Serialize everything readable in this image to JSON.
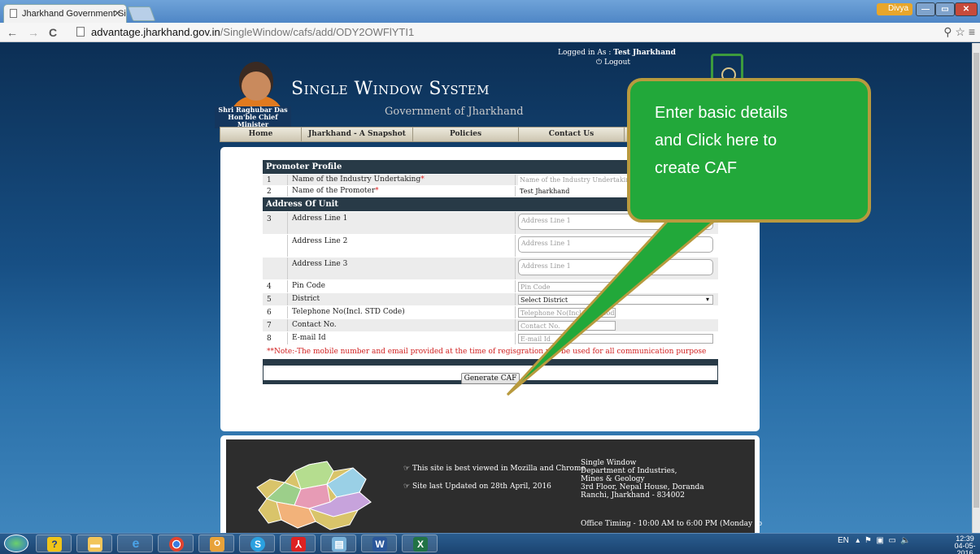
{
  "browser": {
    "tab_title": "Jharkhand Government Si",
    "user_badge": "Divya",
    "url_domain": "advantage.jharkhand.gov.in",
    "url_path": "/SingleWindow/cafs/add/ODY2OWFlYTI1"
  },
  "header": {
    "cm_name": "Shri Raghubar Das",
    "cm_title": "Hon'ble Chief Minister",
    "system_title": "Single Window System",
    "government": "Government of Jharkhand",
    "logged_in_label": "Logged in As :",
    "logged_in_user": "Test Jharkhand",
    "logout": "Logout"
  },
  "menu": [
    "Home",
    "Jharkhand - A Snapshot",
    "Policies",
    "Contact Us"
  ],
  "form": {
    "promoter_section": "Promoter Profile",
    "address_section": "Address Of Unit",
    "rows": [
      {
        "num": "1",
        "label": "Name of the Industry Undertaking",
        "required": "*",
        "placeholder": "Name of the Industry Undertaking",
        "value": ""
      },
      {
        "num": "2",
        "label": "Name of the Promoter",
        "required": "*",
        "placeholder": "",
        "value": "Test Jharkhand"
      },
      {
        "num": "3",
        "label": "Address Line 1",
        "placeholder": "Address Line 1"
      },
      {
        "num": "",
        "label": "Address Line 2",
        "placeholder": "Address Line 1"
      },
      {
        "num": "",
        "label": "Address Line 3",
        "placeholder": "Address Line 1"
      },
      {
        "num": "4",
        "label": "Pin Code",
        "placeholder": "Pin Code"
      },
      {
        "num": "5",
        "label": "District",
        "value": "Select District"
      },
      {
        "num": "6",
        "label": "Telephone No(Incl. STD Code)",
        "placeholder": "Telephone No(Incl. STD Code)"
      },
      {
        "num": "7",
        "label": "Contact No.",
        "placeholder": "Contact No."
      },
      {
        "num": "8",
        "label": "E-mail Id",
        "placeholder": "E-mail Id"
      }
    ],
    "note": "**Note:-The mobile number and email provided at the time of regisgration will be used for all communication purpose",
    "generate_button": "Generate CAF"
  },
  "callout": {
    "line1": "Enter basic details",
    "line2": "and Click here to",
    "line3": "create CAF"
  },
  "footer": {
    "note1": "This site is best viewed in Mozilla and Chrome",
    "note2": "Site last Updated on 28th April, 2016",
    "addr1": "Single Window",
    "addr2": "Department of Industries,",
    "addr3": "Mines & Geology",
    "addr4": "3rd Floor, Nepal House, Doranda",
    "addr5": "Ranchi, Jharkhand - 834002",
    "timing": "Office Timing - 10:00 AM to 6:00 PM (Monday to"
  },
  "taskbar": {
    "lang": "EN",
    "time": "12:39",
    "date": "04-05-2016",
    "apps": [
      "help-icon",
      "explorer-icon",
      "internet-explorer-icon",
      "chrome-icon",
      "outlook-icon",
      "skype-icon",
      "acrobat-icon",
      "notepad-icon",
      "word-icon",
      "excel-icon"
    ]
  },
  "colors": {
    "callout": "#22a83a",
    "header_bg": "#0e3a66",
    "section_bg": "#283a47",
    "note": "#d01f1f"
  }
}
